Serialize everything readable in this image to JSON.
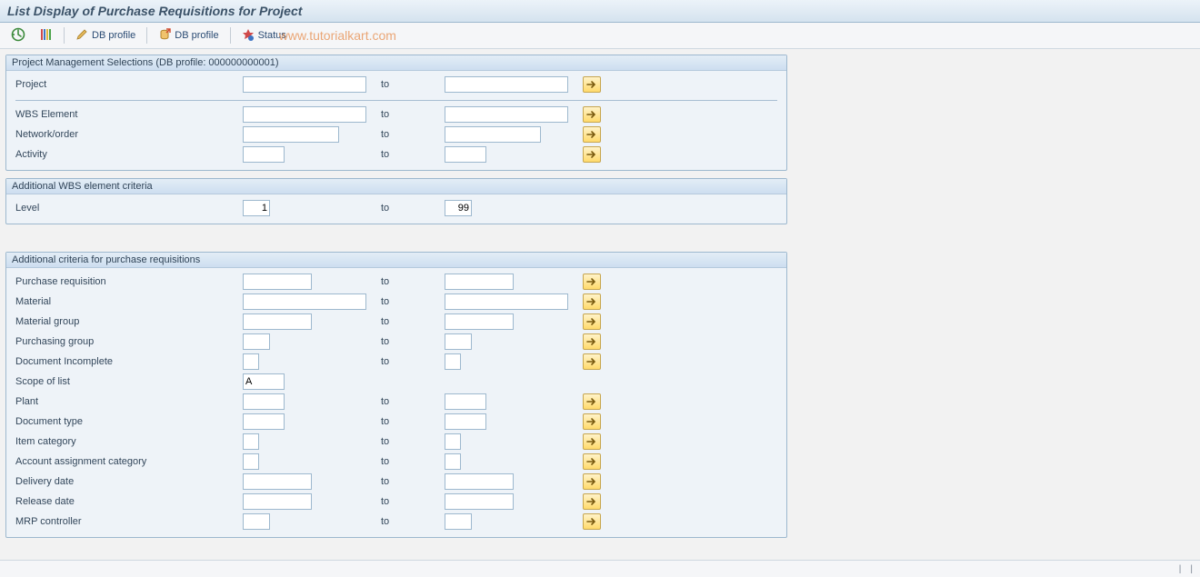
{
  "title": "List Display of Purchase Requisitions for Project",
  "watermark": "www.tutorialkart.com",
  "toolbar": {
    "db_profile_edit": "DB profile",
    "db_profile_pick": "DB profile",
    "status": "Status"
  },
  "labels": {
    "to": "to"
  },
  "group1": {
    "title": "Project Management Selections (DB profile: 000000000001)",
    "rows": {
      "project": {
        "label": "Project",
        "from": "",
        "to": ""
      },
      "wbs": {
        "label": "WBS Element",
        "from": "",
        "to": ""
      },
      "network": {
        "label": "Network/order",
        "from": "",
        "to": ""
      },
      "activity": {
        "label": "Activity",
        "from": "",
        "to": ""
      }
    }
  },
  "group2": {
    "title": "Additional WBS element criteria",
    "rows": {
      "level": {
        "label": "Level",
        "from": "1",
        "to": "99"
      }
    }
  },
  "group3": {
    "title": "Additional criteria for purchase requisitions",
    "rows": {
      "preq": {
        "label": "Purchase requisition",
        "from": "",
        "to": ""
      },
      "material": {
        "label": "Material",
        "from": "",
        "to": ""
      },
      "matgroup": {
        "label": "Material group",
        "from": "",
        "to": ""
      },
      "purgroup": {
        "label": "Purchasing group",
        "from": "",
        "to": ""
      },
      "docinc": {
        "label": "Document Incomplete",
        "from": "",
        "to": ""
      },
      "scope": {
        "label": "Scope of list",
        "from": "A"
      },
      "plant": {
        "label": "Plant",
        "from": "",
        "to": ""
      },
      "doctype": {
        "label": "Document type",
        "from": "",
        "to": ""
      },
      "itemcat": {
        "label": "Item category",
        "from": "",
        "to": ""
      },
      "acctcat": {
        "label": "Account assignment category",
        "from": "",
        "to": ""
      },
      "deldate": {
        "label": "Delivery date",
        "from": "",
        "to": ""
      },
      "reldate": {
        "label": "Release date",
        "from": "",
        "to": ""
      },
      "mrp": {
        "label": "MRP controller",
        "from": "",
        "to": ""
      }
    }
  }
}
